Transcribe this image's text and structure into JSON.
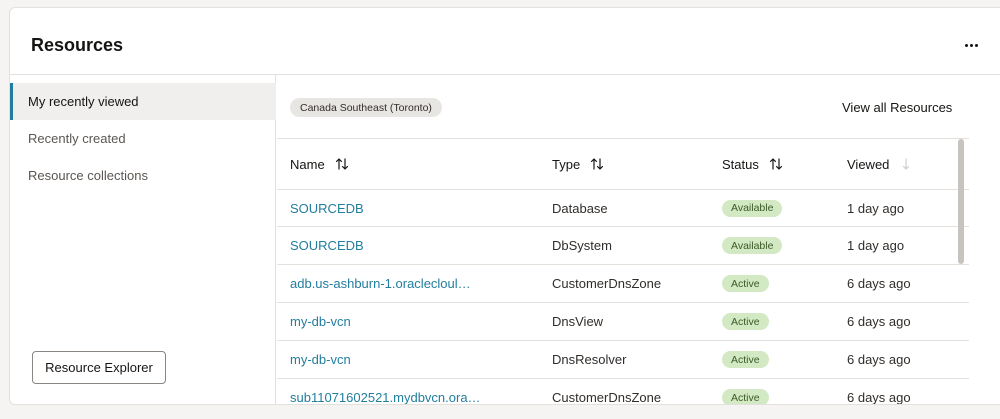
{
  "header": {
    "title": "Resources"
  },
  "sidebar": {
    "items": [
      {
        "label": "My recently viewed",
        "active": true
      },
      {
        "label": "Recently created",
        "active": false
      },
      {
        "label": "Resource collections",
        "active": false
      }
    ],
    "explorer_button": "Resource Explorer"
  },
  "main": {
    "region_chip": "Canada Southeast (Toronto)",
    "view_all_label": "View all Resources",
    "columns": [
      "Name",
      "Type",
      "Status",
      "Viewed"
    ],
    "rows": [
      {
        "name": "SOURCEDB",
        "type": "Database",
        "status": "Available",
        "viewed": "1 day ago"
      },
      {
        "name": "SOURCEDB",
        "type": "DbSystem",
        "status": "Available",
        "viewed": "1 day ago"
      },
      {
        "name": "adb.us-ashburn-1.oraclecloul…",
        "type": "CustomerDnsZone",
        "status": "Active",
        "viewed": "6 days ago"
      },
      {
        "name": "my-db-vcn",
        "type": "DnsView",
        "status": "Active",
        "viewed": "6 days ago"
      },
      {
        "name": "my-db-vcn",
        "type": "DnsResolver",
        "status": "Active",
        "viewed": "6 days ago"
      },
      {
        "name": "sub11071602521.mydbvcn.ora…",
        "type": "CustomerDnsZone",
        "status": "Active",
        "viewed": "6 days ago"
      }
    ]
  },
  "colors": {
    "accent": "#227e9e",
    "badge_bg": "#d3e9c4",
    "badge_text": "#3b5a26"
  }
}
